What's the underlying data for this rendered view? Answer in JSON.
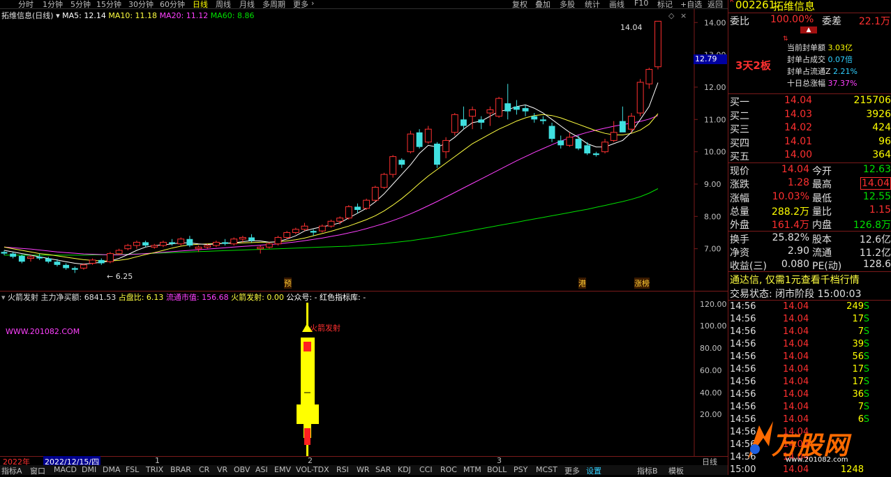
{
  "toolbar": {
    "timeframes": [
      "分时",
      "1分钟",
      "5分钟",
      "15分钟",
      "30分钟",
      "60分钟",
      "日线",
      "周线",
      "月线",
      "多周期",
      "更多"
    ],
    "active_timeframe": "日线",
    "right_buttons": [
      "复权",
      "叠加",
      "多股",
      "统计",
      "画线",
      "F10",
      "标记",
      "+自选",
      "返回"
    ]
  },
  "main": {
    "title": "拓维信息(日线)",
    "ma5": "MA5: 12.14",
    "ma10": "MA10: 11.18",
    "ma20": "MA20: 11.12",
    "ma60": "MA60: 8.86",
    "high_label": "14.04",
    "low_label": "6.25",
    "price_axis": [
      "14.00",
      "13.00",
      "12.00",
      "11.00",
      "10.00",
      "9.00",
      "8.00",
      "7.00"
    ],
    "current_price_tag": "12.79",
    "markers": [
      "预",
      "港",
      "涨榜"
    ]
  },
  "indicator": {
    "name": "火箭发射",
    "main_net_buy": "主力净买额: 6841.53",
    "ratio": "占盘比: 6.13",
    "float_value": "流通市值: 156.68",
    "rocket": "火箭发射: 0.00",
    "wechat": "公众号: -",
    "lib": "红色指标库: -",
    "watermark": "WWW.201082.COM",
    "rocket_label": "火箭发射",
    "axis": [
      "120.00",
      "100.00",
      "80.00",
      "60.00",
      "40.00",
      "20.00"
    ]
  },
  "bottom": {
    "year": "2022年",
    "date": "2022/12/15/四",
    "month_marks": [
      "1",
      "2",
      "3"
    ],
    "period": "日线",
    "tabs": [
      "指标A",
      "窗口",
      "MACD",
      "DMI",
      "DMA",
      "FSL",
      "TRIX",
      "BRAR",
      "CR",
      "VR",
      "OBV",
      "ASI",
      "EMV",
      "VOL-TDX",
      "RSI",
      "WR",
      "SAR",
      "KDJ",
      "CCI",
      "ROC",
      "MTM",
      "BOLL",
      "PSY",
      "MCST",
      "更多",
      "设置",
      "指标B",
      "模板"
    ]
  },
  "panel": {
    "code": "002261",
    "name": "拓维信息",
    "weibi_label": "委比",
    "weibi": "100.00%",
    "weicha_label": "委差",
    "weicha": "22.1万",
    "board_tag": "3天2板",
    "seal": [
      {
        "label": "当前封单额",
        "value": "3.03亿"
      },
      {
        "label": "封单占成交",
        "value": "0.07倍"
      },
      {
        "label": "封单占流通Z",
        "value": "2.21%"
      },
      {
        "label": "十日总涨幅",
        "value": "37.37%"
      }
    ],
    "bids": [
      {
        "label": "买一",
        "price": "14.04",
        "vol": "215706"
      },
      {
        "label": "买二",
        "price": "14.03",
        "vol": "3926"
      },
      {
        "label": "买三",
        "price": "14.02",
        "vol": "424"
      },
      {
        "label": "买四",
        "price": "14.01",
        "vol": "96"
      },
      {
        "label": "买五",
        "price": "14.00",
        "vol": "364"
      }
    ],
    "quote": [
      {
        "l1": "现价",
        "v1": "14.04",
        "l2": "今开",
        "v2": "12.63"
      },
      {
        "l1": "涨跌",
        "v1": "1.28",
        "l2": "最高",
        "v2": "14.04"
      },
      {
        "l1": "涨幅",
        "v1": "10.03%",
        "l2": "最低",
        "v2": "12.55"
      },
      {
        "l1": "总量",
        "v1": "288.2万",
        "l2": "量比",
        "v2": "1.15"
      },
      {
        "l1": "外盘",
        "v1": "161.4万",
        "l2": "内盘",
        "v2": "126.8万"
      }
    ],
    "fund": [
      {
        "l1": "换手",
        "v1": "25.82%",
        "l2": "股本",
        "v2": "12.6亿"
      },
      {
        "l1": "净资",
        "v1": "2.90",
        "l2": "流通",
        "v2": "11.2亿"
      },
      {
        "l1": "收益(三)",
        "v1": "0.080",
        "l2": "PE(动)",
        "v2": "128.6"
      }
    ],
    "ad": "通达信, 仅需1元查看千档行情",
    "status": "交易状态: 闭市阶段 15:00:03",
    "ticks": [
      {
        "t": "14:56",
        "p": "14.04",
        "v": "249",
        "s": "S"
      },
      {
        "t": "14:56",
        "p": "14.04",
        "v": "17",
        "s": "S"
      },
      {
        "t": "14:56",
        "p": "14.04",
        "v": "7",
        "s": "S"
      },
      {
        "t": "14:56",
        "p": "14.04",
        "v": "39",
        "s": "S"
      },
      {
        "t": "14:56",
        "p": "14.04",
        "v": "56",
        "s": "S"
      },
      {
        "t": "14:56",
        "p": "14.04",
        "v": "17",
        "s": "S"
      },
      {
        "t": "14:56",
        "p": "14.04",
        "v": "17",
        "s": "S"
      },
      {
        "t": "14:56",
        "p": "14.04",
        "v": "36",
        "s": "S"
      },
      {
        "t": "14:56",
        "p": "14.04",
        "v": "7",
        "s": "S"
      },
      {
        "t": "14:56",
        "p": "14.04",
        "v": "6",
        "s": "S"
      },
      {
        "t": "14:56",
        "p": "14.04",
        "v": "",
        "s": ""
      },
      {
        "t": "14:56",
        "p": "14.04",
        "v": "",
        "s": ""
      },
      {
        "t": "14:56",
        "p": "14.04",
        "v": "",
        "s": ""
      },
      {
        "t": "15:00",
        "p": "14.04",
        "v": "1248",
        "s": ""
      }
    ],
    "logo": "万股网",
    "logo_url": "www.201082.com"
  },
  "chart_data": {
    "type": "candlestick",
    "price_range": [
      6.0,
      14.2
    ],
    "candles": [
      [
        6.9,
        6.95,
        6.8,
        6.85
      ],
      [
        6.85,
        6.9,
        6.7,
        6.75
      ],
      [
        6.78,
        6.82,
        6.55,
        6.6
      ],
      [
        6.7,
        6.8,
        6.6,
        6.75
      ],
      [
        6.75,
        6.85,
        6.65,
        6.7
      ],
      [
        6.7,
        6.75,
        6.55,
        6.6
      ],
      [
        6.6,
        6.68,
        6.45,
        6.5
      ],
      [
        6.5,
        6.55,
        6.35,
        6.4
      ],
      [
        6.4,
        6.45,
        6.25,
        6.35
      ],
      [
        6.4,
        6.55,
        6.35,
        6.5
      ],
      [
        6.55,
        6.7,
        6.5,
        6.65
      ],
      [
        6.65,
        6.7,
        6.5,
        6.55
      ],
      [
        6.6,
        6.9,
        6.55,
        6.85
      ],
      [
        6.85,
        7.0,
        6.8,
        6.95
      ],
      [
        7.0,
        7.15,
        6.95,
        7.1
      ],
      [
        7.1,
        7.25,
        7.0,
        7.2
      ],
      [
        7.2,
        7.25,
        7.05,
        7.1
      ],
      [
        7.05,
        7.15,
        7.0,
        7.1
      ],
      [
        7.1,
        7.25,
        7.05,
        7.2
      ],
      [
        7.2,
        7.3,
        7.1,
        7.15
      ],
      [
        7.15,
        7.35,
        7.1,
        7.3
      ],
      [
        7.3,
        7.4,
        7.05,
        7.1
      ],
      [
        7.0,
        7.1,
        6.9,
        7.05
      ],
      [
        7.05,
        7.15,
        7.0,
        7.1
      ],
      [
        7.1,
        7.25,
        7.05,
        7.2
      ],
      [
        7.2,
        7.3,
        7.1,
        7.15
      ],
      [
        7.15,
        7.35,
        7.1,
        7.3
      ],
      [
        7.3,
        7.4,
        7.2,
        7.35
      ],
      [
        7.35,
        7.45,
        7.2,
        7.25
      ],
      [
        7.0,
        7.1,
        6.85,
        7.05
      ],
      [
        7.05,
        7.2,
        7.0,
        7.15
      ],
      [
        7.15,
        7.4,
        7.1,
        7.35
      ],
      [
        7.35,
        7.55,
        7.3,
        7.5
      ],
      [
        7.5,
        7.65,
        7.45,
        7.6
      ],
      [
        7.6,
        7.8,
        7.55,
        7.7
      ],
      [
        7.55,
        7.6,
        7.4,
        7.5
      ],
      [
        7.55,
        7.75,
        7.5,
        7.7
      ],
      [
        7.7,
        7.9,
        7.65,
        7.85
      ],
      [
        7.85,
        8.0,
        7.75,
        7.95
      ],
      [
        7.95,
        8.35,
        7.9,
        8.3
      ],
      [
        8.3,
        8.4,
        8.1,
        8.2
      ],
      [
        8.25,
        8.55,
        8.2,
        8.5
      ],
      [
        8.5,
        8.95,
        8.45,
        8.9
      ],
      [
        8.9,
        9.35,
        8.85,
        9.3
      ],
      [
        9.3,
        9.9,
        9.2,
        9.85
      ],
      [
        9.75,
        9.8,
        9.5,
        9.6
      ],
      [
        10.0,
        10.65,
        9.95,
        10.55
      ],
      [
        10.6,
        10.7,
        10.1,
        10.15
      ],
      [
        10.3,
        10.8,
        10.25,
        10.7
      ],
      [
        10.25,
        10.3,
        9.5,
        9.6
      ],
      [
        10.0,
        10.45,
        9.8,
        10.35
      ],
      [
        10.6,
        11.2,
        10.5,
        11.15
      ],
      [
        11.0,
        11.4,
        10.7,
        10.8
      ],
      [
        11.1,
        11.4,
        10.7,
        11.3
      ],
      [
        11.0,
        11.1,
        10.7,
        10.9
      ],
      [
        11.2,
        11.4,
        10.8,
        11.3
      ],
      [
        11.1,
        11.7,
        11.05,
        11.65
      ],
      [
        11.5,
        12.1,
        11.0,
        11.25
      ],
      [
        11.4,
        11.6,
        11.15,
        11.3
      ],
      [
        11.35,
        11.45,
        11.1,
        11.25
      ],
      [
        11.1,
        11.2,
        10.9,
        11.0
      ],
      [
        11.0,
        11.1,
        10.85,
        10.95
      ],
      [
        10.8,
        10.9,
        10.3,
        10.4
      ],
      [
        10.35,
        10.5,
        10.1,
        10.2
      ],
      [
        10.2,
        10.6,
        10.15,
        10.45
      ],
      [
        10.4,
        10.5,
        10.05,
        10.1
      ],
      [
        10.2,
        10.3,
        9.9,
        9.95
      ],
      [
        9.95,
        10.0,
        9.85,
        9.9
      ],
      [
        10.0,
        10.4,
        9.95,
        10.3
      ],
      [
        10.35,
        10.95,
        10.3,
        10.6
      ],
      [
        10.95,
        11.4,
        10.8,
        10.6
      ],
      [
        10.7,
        11.2,
        10.6,
        11.1
      ],
      [
        11.2,
        12.25,
        11.1,
        12.15
      ],
      [
        12.1,
        12.6,
        11.95,
        12.55
      ],
      [
        12.63,
        14.04,
        12.55,
        14.04
      ]
    ],
    "ma5": [
      6.95,
      6.9,
      6.85,
      6.8,
      6.75,
      6.7,
      6.65,
      6.6,
      6.55,
      6.52,
      6.55,
      6.58,
      6.62,
      6.7,
      6.82,
      6.95,
      7.05,
      7.1,
      7.12,
      7.15,
      7.18,
      7.18,
      7.15,
      7.13,
      7.15,
      7.17,
      7.18,
      7.22,
      7.25,
      7.24,
      7.2,
      7.22,
      7.3,
      7.4,
      7.55,
      7.62,
      7.68,
      7.73,
      7.8,
      7.95,
      8.1,
      8.25,
      8.45,
      8.7,
      9.0,
      9.3,
      9.6,
      9.95,
      10.2,
      10.15,
      10.25,
      10.45,
      10.7,
      10.9,
      10.95,
      11.1,
      11.25,
      11.3,
      11.4,
      11.45,
      11.35,
      11.2,
      11.0,
      10.8,
      10.6,
      10.45,
      10.25,
      10.15,
      10.15,
      10.25,
      10.35,
      10.6,
      11.0,
      11.4,
      12.14
    ],
    "ma10": [
      7.05,
      7.0,
      6.95,
      6.9,
      6.85,
      6.82,
      6.78,
      6.74,
      6.7,
      6.66,
      6.64,
      6.62,
      6.62,
      6.64,
      6.68,
      6.75,
      6.82,
      6.88,
      6.95,
      7.02,
      7.08,
      7.12,
      7.14,
      7.15,
      7.16,
      7.17,
      7.17,
      7.18,
      7.19,
      7.2,
      7.2,
      7.21,
      7.24,
      7.28,
      7.33,
      7.4,
      7.47,
      7.54,
      7.62,
      7.7,
      7.8,
      7.9,
      8.02,
      8.17,
      8.35,
      8.55,
      8.78,
      9.02,
      9.25,
      9.45,
      9.65,
      9.85,
      10.05,
      10.25,
      10.4,
      10.55,
      10.7,
      10.82,
      10.95,
      11.05,
      11.12,
      11.15,
      11.12,
      11.05,
      10.95,
      10.85,
      10.75,
      10.65,
      10.57,
      10.52,
      10.52,
      10.57,
      10.67,
      10.85,
      11.18
    ],
    "ma20": [
      7.05,
      7.03,
      7.01,
      6.99,
      6.96,
      6.93,
      6.9,
      6.88,
      6.86,
      6.84,
      6.83,
      6.82,
      6.81,
      6.81,
      6.82,
      6.83,
      6.85,
      6.87,
      6.89,
      6.91,
      6.93,
      6.95,
      6.97,
      6.99,
      7.01,
      7.03,
      7.05,
      7.07,
      7.09,
      7.11,
      7.13,
      7.15,
      7.18,
      7.21,
      7.25,
      7.29,
      7.33,
      7.38,
      7.43,
      7.49,
      7.55,
      7.62,
      7.7,
      7.78,
      7.87,
      7.97,
      8.08,
      8.2,
      8.33,
      8.46,
      8.6,
      8.74,
      8.88,
      9.02,
      9.16,
      9.3,
      9.44,
      9.58,
      9.72,
      9.85,
      9.98,
      10.1,
      10.22,
      10.33,
      10.43,
      10.52,
      10.6,
      10.67,
      10.73,
      10.79,
      10.84,
      10.89,
      10.94,
      11.01,
      11.12
    ],
    "ma60": [
      6.8,
      6.8,
      6.8,
      6.8,
      6.8,
      6.8,
      6.8,
      6.8,
      6.8,
      6.8,
      6.81,
      6.81,
      6.82,
      6.82,
      6.83,
      6.84,
      6.85,
      6.86,
      6.87,
      6.88,
      6.89,
      6.9,
      6.91,
      6.92,
      6.93,
      6.94,
      6.95,
      6.96,
      6.97,
      6.98,
      6.99,
      7.0,
      7.01,
      7.02,
      7.03,
      7.04,
      7.05,
      7.06,
      7.07,
      7.08,
      7.1,
      7.12,
      7.14,
      7.16,
      7.19,
      7.22,
      7.25,
      7.29,
      7.33,
      7.37,
      7.42,
      7.47,
      7.52,
      7.57,
      7.62,
      7.67,
      7.72,
      7.77,
      7.82,
      7.87,
      7.92,
      7.97,
      8.02,
      8.07,
      8.12,
      8.17,
      8.22,
      8.28,
      8.34,
      8.4,
      8.46,
      8.53,
      8.61,
      8.72,
      8.86
    ],
    "colors": {
      "up": "#ff3030",
      "down": "#40e0e0",
      "ma5": "#ffffff",
      "ma10": "#ffff40",
      "ma20": "#ff40ff",
      "ma60": "#00e000"
    }
  }
}
